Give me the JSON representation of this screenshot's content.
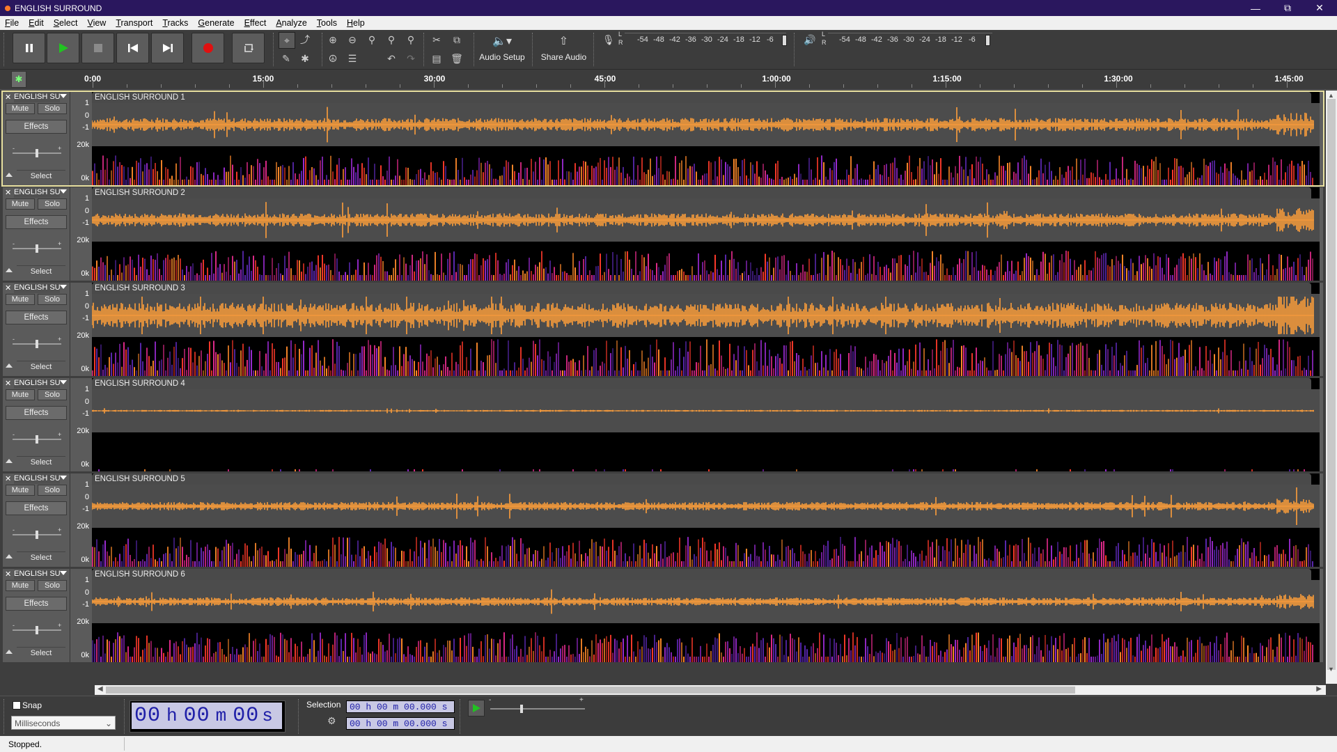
{
  "window": {
    "title": "ENGLISH SURROUND",
    "controls": [
      "minimize",
      "restore",
      "close"
    ]
  },
  "menu": [
    "File",
    "Edit",
    "Select",
    "View",
    "Transport",
    "Tracks",
    "Generate",
    "Effect",
    "Analyze",
    "Tools",
    "Help"
  ],
  "toolbar": {
    "audio_setup_label": "Audio Setup",
    "share_audio_label": "Share Audio",
    "record_meter_ticks": [
      "-54",
      "-48",
      "-42",
      "-36",
      "-30",
      "-24",
      "-18",
      "-12",
      "-6"
    ],
    "playback_meter_ticks": [
      "-54",
      "-48",
      "-42",
      "-36",
      "-30",
      "-24",
      "-18",
      "-12",
      "-6"
    ],
    "meter_channels": [
      "L",
      "R"
    ],
    "accent_play": "#22c222",
    "accent_record": "#e01010"
  },
  "timeline": {
    "labels": [
      "0:00",
      "15:00",
      "30:00",
      "45:00",
      "1:00:00",
      "1:15:00",
      "1:30:00",
      "1:45:00"
    ]
  },
  "tracks": [
    {
      "short_name": "ENGLISH SU",
      "clip_name": "ENGLISH SURROUND 1",
      "mute": "Mute",
      "solo": "Solo",
      "effects": "Effects",
      "select": "Select",
      "scale": [
        "1",
        "0",
        "-1",
        "20k",
        "0k"
      ],
      "level": "loud",
      "selected": true
    },
    {
      "short_name": "ENGLISH SU",
      "clip_name": "ENGLISH SURROUND 2",
      "mute": "Mute",
      "solo": "Solo",
      "effects": "Effects",
      "select": "Select",
      "scale": [
        "1",
        "0",
        "-1",
        "20k",
        "0k"
      ],
      "level": "loud",
      "selected": false
    },
    {
      "short_name": "ENGLISH SU",
      "clip_name": "ENGLISH SURROUND 3",
      "mute": "Mute",
      "solo": "Solo",
      "effects": "Effects",
      "select": "Select",
      "scale": [
        "1",
        "0",
        "-1",
        "20k",
        "0k"
      ],
      "level": "dense",
      "selected": false
    },
    {
      "short_name": "ENGLISH SU",
      "clip_name": "ENGLISH SURROUND 4",
      "mute": "Mute",
      "solo": "Solo",
      "effects": "Effects",
      "select": "Select",
      "scale": [
        "1",
        "0",
        "-1",
        "20k",
        "0k"
      ],
      "level": "quiet",
      "selected": false
    },
    {
      "short_name": "ENGLISH SU",
      "clip_name": "ENGLISH SURROUND 5",
      "mute": "Mute",
      "solo": "Solo",
      "effects": "Effects",
      "select": "Select",
      "scale": [
        "1",
        "0",
        "-1",
        "20k",
        "0k"
      ],
      "level": "medium",
      "selected": false
    },
    {
      "short_name": "ENGLISH SU",
      "clip_name": "ENGLISH SURROUND 6",
      "mute": "Mute",
      "solo": "Solo",
      "effects": "Effects",
      "select": "Select",
      "scale": [
        "1",
        "0",
        "-1",
        "20k",
        "0k"
      ],
      "level": "medium",
      "selected": false
    }
  ],
  "bottom": {
    "snap_label": "Snap",
    "snap_unit": "Milliseconds",
    "time_display": {
      "h": "00",
      "h_unit": "h",
      "m": "00",
      "m_unit": "m",
      "s": "00",
      "s_unit": "s"
    },
    "selection_label": "Selection",
    "selection_start": "00 h 00 m 00.000 s",
    "selection_end": "00 h 00 m 00.000 s",
    "play_at_speed_minus": "-",
    "play_at_speed_plus": "+"
  },
  "status": "Stopped.",
  "colors": {
    "waveform": "#ff9f3a",
    "title_bar": "#2a175e",
    "background": "#3e3e3e"
  }
}
